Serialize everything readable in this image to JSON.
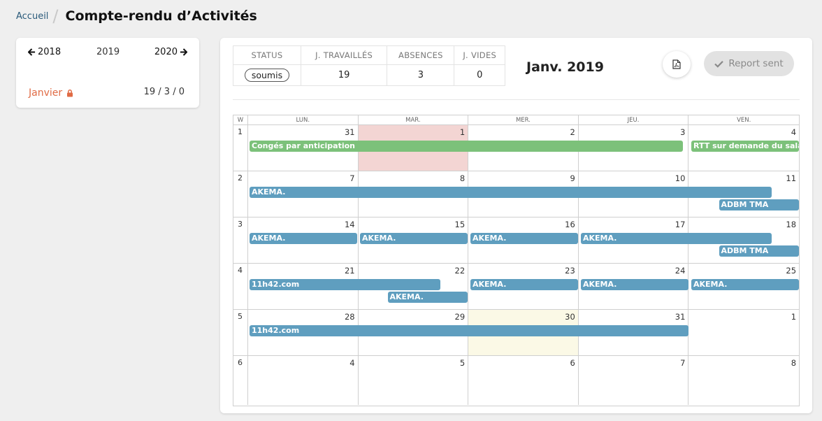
{
  "breadcrumb": {
    "home": "Accueil",
    "title": "Compte-rendu d’Activités"
  },
  "year_nav": {
    "prev": "2018",
    "current": "2019",
    "next": "2020"
  },
  "month_item": {
    "label": "Janvier",
    "stats": "19 / 3 / 0"
  },
  "stats_table": {
    "headers": [
      "STATUS",
      "J. TRAVAILLÉS",
      "ABSENCES",
      "J. VIDES"
    ],
    "status": "soumis",
    "worked": "19",
    "absences": "3",
    "empty": "0"
  },
  "month_title": "Janv. 2019",
  "report_button": "Report sent",
  "calendar": {
    "header": [
      "W",
      "LUN.",
      "MAR.",
      "MER.",
      "JEU.",
      "VEN."
    ],
    "weeks": [
      {
        "num": "1",
        "days": [
          "31",
          "1",
          "2",
          "3",
          "4"
        ]
      },
      {
        "num": "2",
        "days": [
          "7",
          "8",
          "9",
          "10",
          "11"
        ]
      },
      {
        "num": "3",
        "days": [
          "14",
          "15",
          "16",
          "17",
          "18"
        ]
      },
      {
        "num": "4",
        "days": [
          "21",
          "22",
          "23",
          "24",
          "25"
        ]
      },
      {
        "num": "5",
        "days": [
          "28",
          "29",
          "30",
          "31",
          "1"
        ]
      },
      {
        "num": "6",
        "days": [
          "4",
          "5",
          "6",
          "7",
          "8"
        ]
      }
    ],
    "events": [
      {
        "label": "Congés par anticipation",
        "color": "green",
        "week": 0,
        "start": 0,
        "end": 3.95,
        "lane": 0
      },
      {
        "label": "RTT sur demande du salarié",
        "color": "green",
        "week": 0,
        "start": 4,
        "end": 5,
        "lane": 0
      },
      {
        "label": "AKEMA.",
        "color": "blue",
        "week": 1,
        "start": 0,
        "end": 4.75,
        "lane": 0
      },
      {
        "label": "ADBM TMA",
        "color": "blue",
        "week": 1,
        "start": 4.25,
        "end": 5,
        "lane": 1
      },
      {
        "label": "AKEMA.",
        "color": "blue",
        "week": 2,
        "start": 0,
        "end": 1,
        "lane": 0
      },
      {
        "label": "AKEMA.",
        "color": "blue",
        "week": 2,
        "start": 1,
        "end": 2,
        "lane": 0
      },
      {
        "label": "AKEMA.",
        "color": "blue",
        "week": 2,
        "start": 2,
        "end": 3,
        "lane": 0
      },
      {
        "label": "AKEMA.",
        "color": "blue",
        "week": 2,
        "start": 3,
        "end": 4.75,
        "lane": 0
      },
      {
        "label": "ADBM TMA",
        "color": "blue",
        "week": 2,
        "start": 4.25,
        "end": 5,
        "lane": 1
      },
      {
        "label": "11h42.com",
        "color": "blue",
        "week": 3,
        "start": 0,
        "end": 1.75,
        "lane": 0
      },
      {
        "label": "AKEMA.",
        "color": "blue",
        "week": 3,
        "start": 1.25,
        "end": 2,
        "lane": 1
      },
      {
        "label": "AKEMA.",
        "color": "blue",
        "week": 3,
        "start": 2,
        "end": 3,
        "lane": 0
      },
      {
        "label": "AKEMA.",
        "color": "blue",
        "week": 3,
        "start": 3,
        "end": 4,
        "lane": 0
      },
      {
        "label": "AKEMA.",
        "color": "blue",
        "week": 3,
        "start": 4,
        "end": 5,
        "lane": 0
      },
      {
        "label": "11h42.com",
        "color": "blue",
        "week": 4,
        "start": 0,
        "end": 4,
        "lane": 0
      }
    ]
  }
}
